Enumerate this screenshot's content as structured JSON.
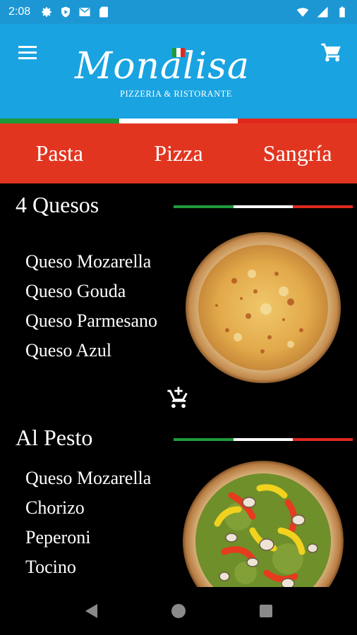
{
  "status_bar": {
    "time": "2:08",
    "icons": [
      "gear-icon",
      "shield-icon",
      "gmail-icon",
      "sd-card-icon",
      "wifi-icon",
      "signal-icon",
      "battery-icon"
    ]
  },
  "app_bar": {
    "logo_text": "Monalisa",
    "logo_subtitle": "PIZZERIA & RISTORANTE",
    "menu_icon": "hamburger-menu-icon",
    "cart_icon": "shopping-cart-icon"
  },
  "colors": {
    "status_bar": "#1c97d4",
    "app_bar": "#19a3e1",
    "tabs_bg": "#e23520",
    "italy_green": "#1e9a3a",
    "italy_white": "#ffffff",
    "italy_red": "#e0281e",
    "background": "#000000"
  },
  "tabs": [
    {
      "label": "Pasta"
    },
    {
      "label": "Pizza"
    },
    {
      "label": "Sangría"
    }
  ],
  "menu_items": [
    {
      "title": "4 Quesos",
      "ingredients": [
        "Queso Mozarella",
        "Queso Gouda",
        "Queso Parmesano",
        "Queso Azul"
      ],
      "add_to_cart_icon": "add-shopping-cart-icon"
    },
    {
      "title": "Al Pesto",
      "ingredients": [
        "Queso Mozarella",
        "Chorizo",
        "Peperoni",
        "Tocino"
      ]
    }
  ],
  "nav_bar": {
    "icons": [
      "back-triangle-icon",
      "home-circle-icon",
      "recents-square-icon"
    ]
  }
}
